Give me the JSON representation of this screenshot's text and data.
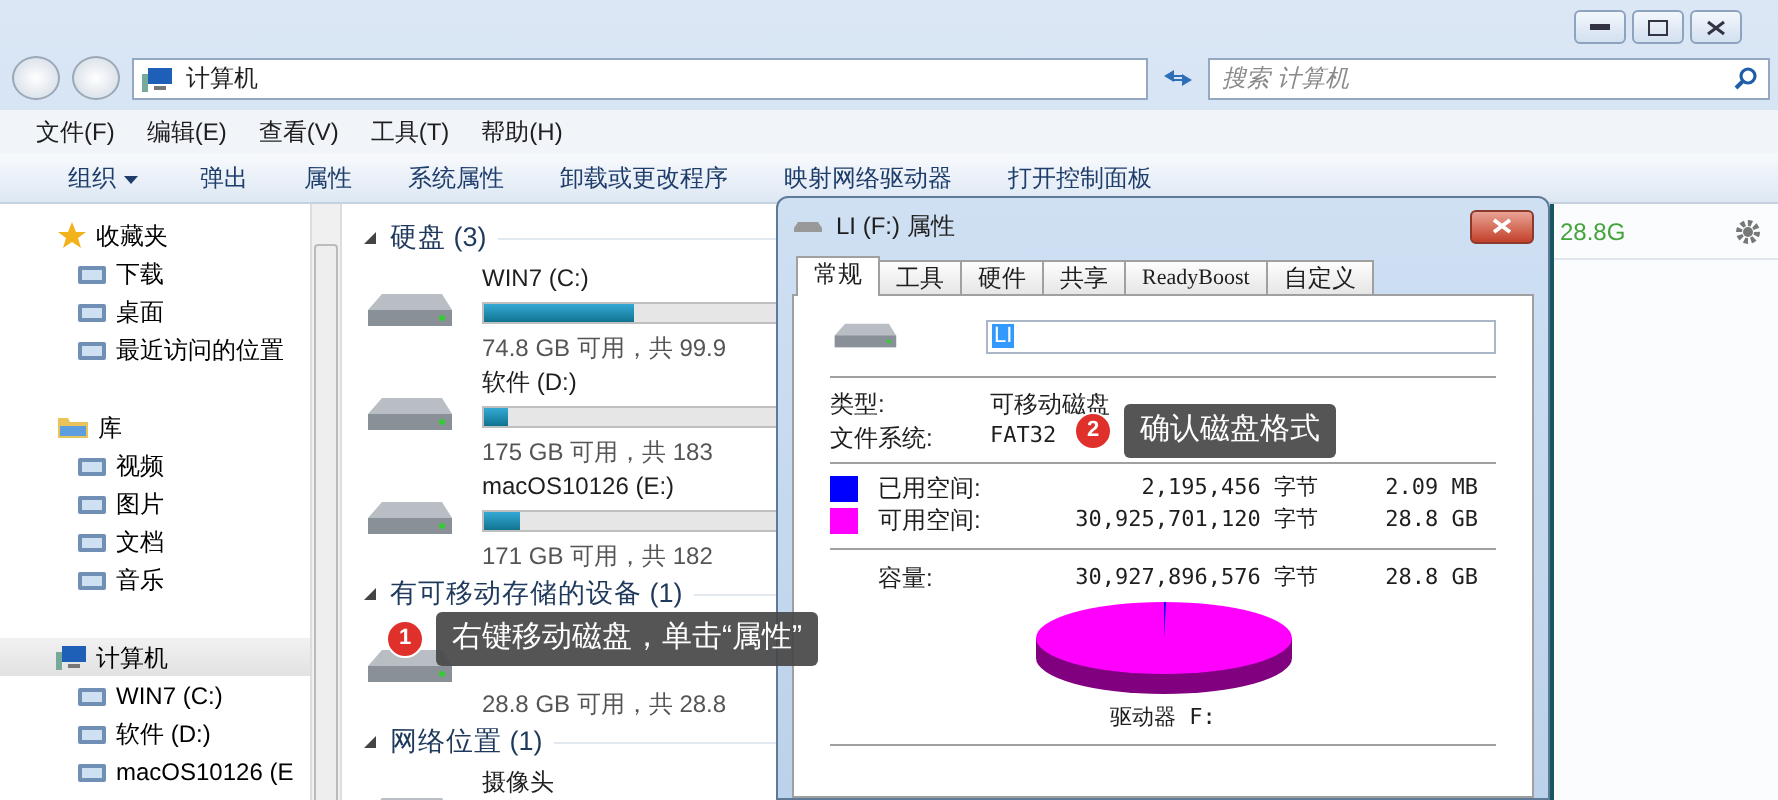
{
  "address_bar": {
    "breadcrumb": "计算机"
  },
  "search": {
    "placeholder": "搜索 计算机"
  },
  "menu": [
    "文件(F)",
    "编辑(E)",
    "查看(V)",
    "工具(T)",
    "帮助(H)"
  ],
  "toolbar": [
    {
      "label": "组织",
      "kind": "menu"
    },
    {
      "label": "弹出",
      "kind": "button"
    },
    {
      "label": "属性",
      "kind": "button"
    },
    {
      "label": "系统属性",
      "kind": "button"
    },
    {
      "label": "卸载或更改程序",
      "kind": "button"
    },
    {
      "label": "映射网络驱动器",
      "kind": "button"
    },
    {
      "label": "打开控制面板",
      "kind": "button"
    }
  ],
  "sidebar": [
    {
      "label": "收藏夹",
      "selected": false,
      "children": [
        {
          "label": "下载",
          "selected": false
        },
        {
          "label": "桌面",
          "selected": false
        },
        {
          "label": "最近访问的位置",
          "selected": false
        }
      ]
    },
    {
      "label": "库",
      "selected": false,
      "children": [
        {
          "label": "视频",
          "selected": false
        },
        {
          "label": "图片",
          "selected": false
        },
        {
          "label": "文档",
          "selected": false
        },
        {
          "label": "音乐",
          "selected": false
        }
      ]
    },
    {
      "label": "计算机",
      "selected": true,
      "children": [
        {
          "label": "WIN7 (C:)",
          "selected": false
        },
        {
          "label": "软件 (D:)",
          "selected": false
        },
        {
          "label": "macOS10126 (E",
          "selected": false
        }
      ]
    }
  ],
  "content": [
    {
      "title": "硬盘 (3)",
      "items": [
        {
          "name": "WIN7 (C:)",
          "level": 0.25,
          "detail": "74.8 GB 可用，共 99.9"
        },
        {
          "name": "软件 (D:)",
          "level": 0.04,
          "detail": "175 GB 可用，共 183"
        },
        {
          "name": "macOS10126 (E:)",
          "level": 0.06,
          "detail": "171 GB 可用，共 182"
        }
      ]
    },
    {
      "title": "有可移动存储的设备 (1)",
      "items": [
        {
          "detail": "28.8 GB 可用，共 28.8"
        }
      ]
    },
    {
      "title": "网络位置 (1)",
      "items": [
        {
          "name": "摄像头"
        }
      ]
    }
  ],
  "details_strip": {
    "text": "28.8G"
  },
  "dialog": {
    "title": "LI (F:) 属性",
    "tabs": [
      {
        "label": "常规",
        "selected": true
      },
      {
        "label": "工具",
        "selected": false
      },
      {
        "label": "硬件",
        "selected": false
      },
      {
        "label": "共享",
        "selected": false
      },
      {
        "label": "ReadyBoost",
        "selected": false
      },
      {
        "label": "自定义",
        "selected": false
      }
    ],
    "name_value": "LI",
    "properties": [
      {
        "label": "类型:",
        "value": "可移动磁盘"
      },
      {
        "label": "文件系统:",
        "value": "FAT32"
      }
    ],
    "space": [
      {
        "label": "已用空间:",
        "bytes": "2,195,456 字节",
        "size": "2.09 MB",
        "color": "#0000ff"
      },
      {
        "label": "可用空间:",
        "bytes": "30,925,701,120 字节",
        "size": "28.8 GB",
        "color": "#ff00ff"
      }
    ],
    "capacity": {
      "label": "容量:",
      "bytes": "30,927,896,576 字节",
      "size": "28.8 GB"
    },
    "drive_label": "驱动器 F:"
  },
  "callouts": [
    {
      "number": "1",
      "text": "右键移动磁盘，单击“属性”"
    },
    {
      "number": "2",
      "text": "确认磁盘格式"
    }
  ]
}
